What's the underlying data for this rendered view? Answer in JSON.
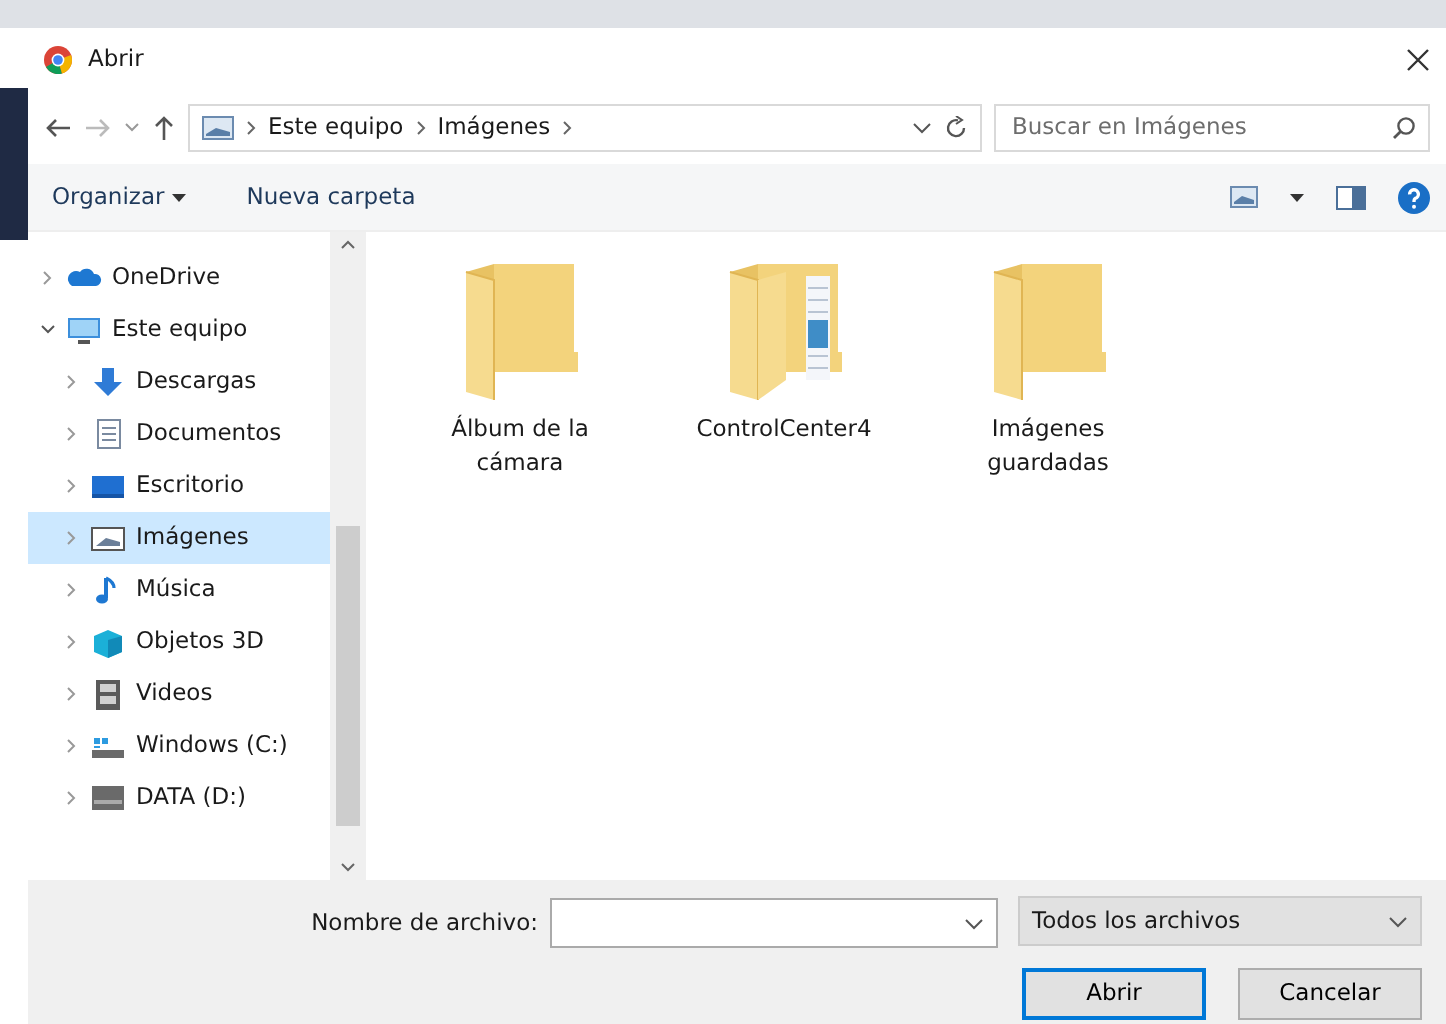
{
  "window": {
    "title": "Abrir"
  },
  "address": {
    "crumbs": [
      "Este equipo",
      "Imágenes"
    ]
  },
  "search": {
    "placeholder": "Buscar en Imágenes"
  },
  "toolbar": {
    "organize": "Organizar",
    "new_folder": "Nueva carpeta"
  },
  "tree": [
    {
      "label": "OneDrive",
      "expanded": false,
      "selected": false
    },
    {
      "label": "Este equipo",
      "expanded": true,
      "selected": false,
      "children": [
        {
          "label": "Descargas",
          "expanded": false,
          "selected": false
        },
        {
          "label": "Documentos",
          "expanded": false,
          "selected": false
        },
        {
          "label": "Escritorio",
          "expanded": false,
          "selected": false
        },
        {
          "label": "Imágenes",
          "expanded": false,
          "selected": true
        },
        {
          "label": "Música",
          "expanded": false,
          "selected": false
        },
        {
          "label": "Objetos 3D",
          "expanded": false,
          "selected": false
        },
        {
          "label": "Videos",
          "expanded": false,
          "selected": false
        },
        {
          "label": "Windows (C:)",
          "expanded": false,
          "selected": false
        },
        {
          "label": "DATA (D:)",
          "expanded": false,
          "selected": false
        }
      ]
    }
  ],
  "files": [
    {
      "name": "Álbum de la cámara",
      "kind": "folder"
    },
    {
      "name": "ControlCenter4",
      "kind": "folder-with-files"
    },
    {
      "name": "Imágenes guardadas",
      "kind": "folder"
    }
  ],
  "filename": {
    "label": "Nombre de archivo:"
  },
  "filter": {
    "value": "Todos los archivos"
  },
  "buttons": [
    "Abrir",
    "Cancelar"
  ]
}
